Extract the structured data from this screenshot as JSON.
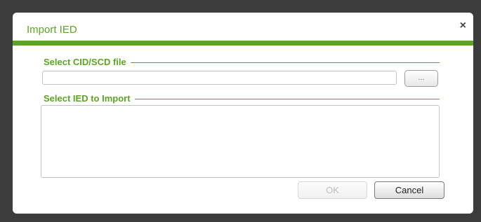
{
  "dialog": {
    "title": "Import IED",
    "close_glyph": "×",
    "accent_color": "#5aa522"
  },
  "file_section": {
    "label": "Select CID/SCD file",
    "input_value": "",
    "browse_label": "..."
  },
  "ied_section": {
    "label": "Select IED to Import",
    "items": []
  },
  "buttons": {
    "ok_label": "OK",
    "ok_enabled": false,
    "cancel_label": "Cancel"
  }
}
